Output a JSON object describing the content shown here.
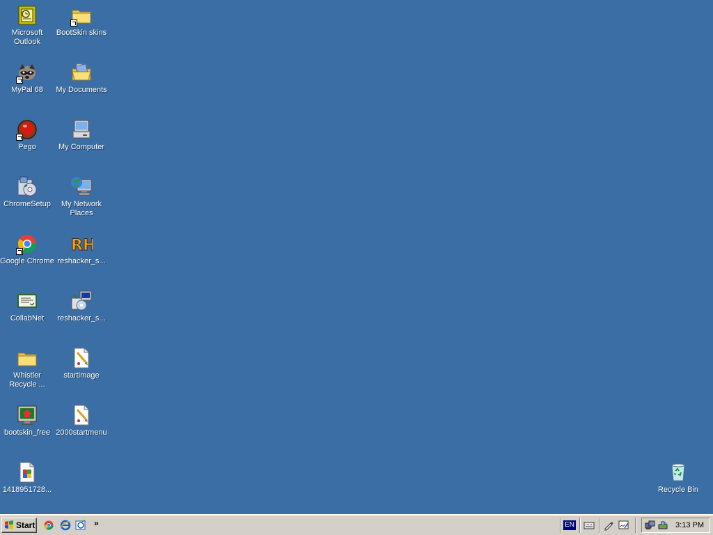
{
  "desktop": {
    "icons": [
      {
        "label": "Microsoft Outlook"
      },
      {
        "label": "BootSkin skins"
      },
      {
        "label": "MyPal 68"
      },
      {
        "label": "My Documents"
      },
      {
        "label": "Pego"
      },
      {
        "label": "My Computer"
      },
      {
        "label": "ChromeSetup"
      },
      {
        "label": "My Network Places"
      },
      {
        "label": "Google Chrome"
      },
      {
        "label": "reshacker_s..."
      },
      {
        "label": "CollabNet"
      },
      {
        "label": "reshacker_s..."
      },
      {
        "label": "Whistler Recycle ..."
      },
      {
        "label": "startimage"
      },
      {
        "label": "bootskin_free"
      },
      {
        "label": "2000startmenu"
      },
      {
        "label": "1418951728..."
      },
      {
        "label": "Recycle Bin"
      }
    ]
  },
  "taskbar": {
    "start_label": "Start",
    "quick_launch_overflow": "»",
    "language": "EN",
    "clock": "3:13 PM"
  },
  "colors": {
    "desktop_background": "#3a6ea5",
    "taskbar": "#d4d0c8"
  }
}
